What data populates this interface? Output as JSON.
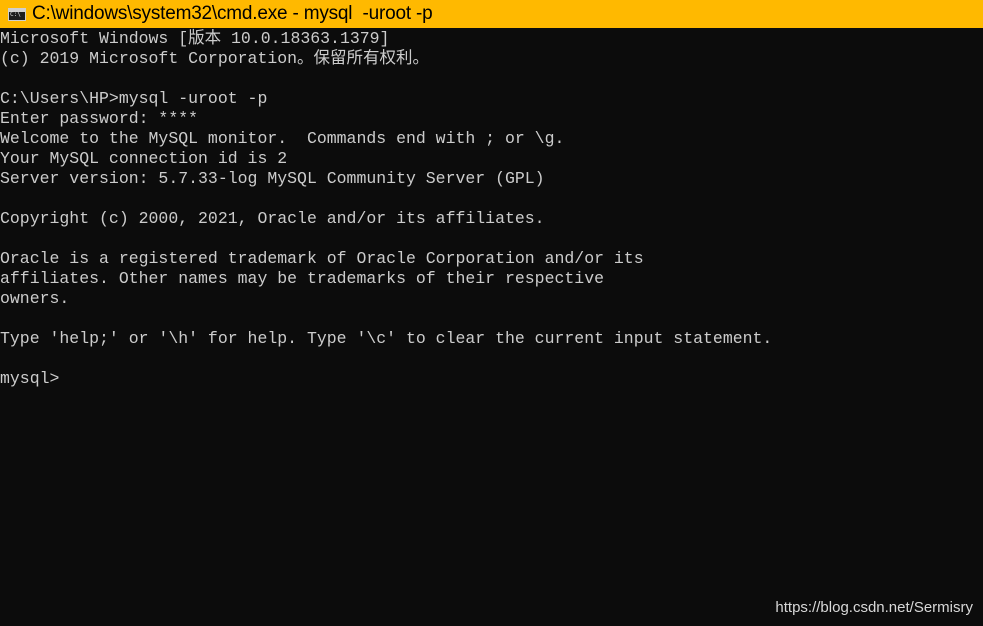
{
  "window": {
    "title": "C:\\windows\\system32\\cmd.exe - mysql  -uroot -p",
    "icon": "cmd-icon"
  },
  "console": {
    "lines": [
      "Microsoft Windows [版本 10.0.18363.1379]",
      "(c) 2019 Microsoft Corporation。保留所有权利。",
      "",
      "C:\\Users\\HP>mysql -uroot -p",
      "Enter password: ****",
      "Welcome to the MySQL monitor.  Commands end with ; or \\g.",
      "Your MySQL connection id is 2",
      "Server version: 5.7.33-log MySQL Community Server (GPL)",
      "",
      "Copyright (c) 2000, 2021, Oracle and/or its affiliates.",
      "",
      "Oracle is a registered trademark of Oracle Corporation and/or its",
      "affiliates. Other names may be trademarks of their respective",
      "owners.",
      "",
      "Type 'help;' or '\\h' for help. Type '\\c' to clear the current input statement.",
      "",
      "mysql>"
    ]
  },
  "watermark": "https://blog.csdn.net/Sermisry",
  "colors": {
    "titlebar": "#ffb900",
    "background": "#0c0c0c",
    "text": "#cccccc"
  }
}
